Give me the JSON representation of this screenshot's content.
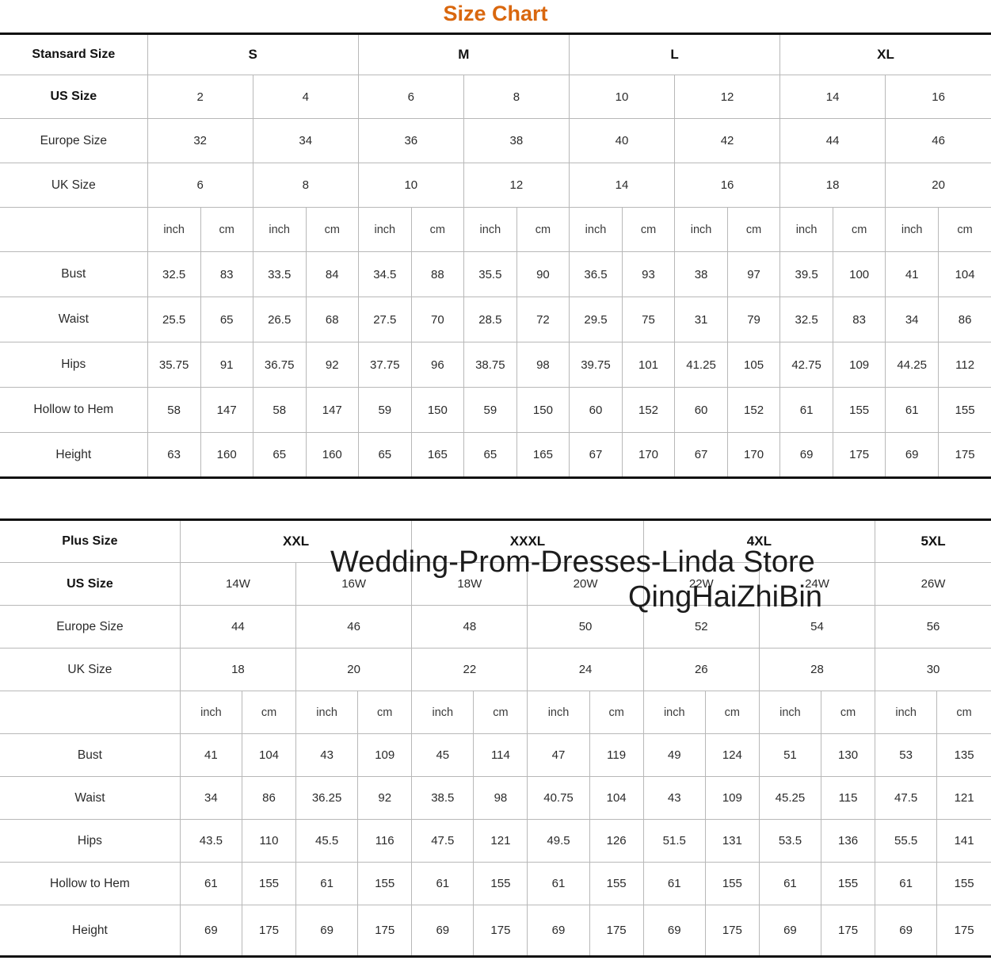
{
  "title": "Size Chart",
  "accent_color": "#d9670e",
  "watermark": {
    "line1": "Wedding-Prom-Dresses-Linda Store",
    "line2": "QingHaiZhiBin"
  },
  "units": {
    "inch": "inch",
    "cm": "cm"
  },
  "table1": {
    "corner_label": "Stansard Size",
    "groups": [
      {
        "label": "S",
        "span": 2
      },
      {
        "label": "M",
        "span": 2
      },
      {
        "label": "L",
        "span": 2
      },
      {
        "label": "XL",
        "span": 2
      }
    ],
    "rows": [
      {
        "label": "US Size",
        "bold": true,
        "values": [
          "2",
          "4",
          "6",
          "8",
          "10",
          "12",
          "14",
          "16"
        ]
      },
      {
        "label": "Europe Size",
        "bold": false,
        "values": [
          "32",
          "34",
          "36",
          "38",
          "40",
          "42",
          "44",
          "46"
        ]
      },
      {
        "label": "UK Size",
        "bold": false,
        "values": [
          "6",
          "8",
          "10",
          "12",
          "14",
          "16",
          "18",
          "20"
        ]
      }
    ],
    "unit_row": {
      "label": "",
      "units": [
        "inch",
        "cm",
        "inch",
        "cm",
        "inch",
        "cm",
        "inch",
        "cm",
        "inch",
        "cm",
        "inch",
        "cm",
        "inch",
        "cm",
        "inch",
        "cm"
      ]
    },
    "measure_rows": [
      {
        "label": "Bust",
        "values": [
          "32.5",
          "83",
          "33.5",
          "84",
          "34.5",
          "88",
          "35.5",
          "90",
          "36.5",
          "93",
          "38",
          "97",
          "39.5",
          "100",
          "41",
          "104"
        ]
      },
      {
        "label": "Waist",
        "values": [
          "25.5",
          "65",
          "26.5",
          "68",
          "27.5",
          "70",
          "28.5",
          "72",
          "29.5",
          "75",
          "31",
          "79",
          "32.5",
          "83",
          "34",
          "86"
        ]
      },
      {
        "label": "Hips",
        "values": [
          "35.75",
          "91",
          "36.75",
          "92",
          "37.75",
          "96",
          "38.75",
          "98",
          "39.75",
          "101",
          "41.25",
          "105",
          "42.75",
          "109",
          "44.25",
          "112"
        ]
      },
      {
        "label": "Hollow to Hem",
        "values": [
          "58",
          "147",
          "58",
          "147",
          "59",
          "150",
          "59",
          "150",
          "60",
          "152",
          "60",
          "152",
          "61",
          "155",
          "61",
          "155"
        ]
      },
      {
        "label": "Height",
        "values": [
          "63",
          "160",
          "65",
          "160",
          "65",
          "165",
          "65",
          "165",
          "67",
          "170",
          "67",
          "170",
          "69",
          "175",
          "69",
          "175"
        ]
      }
    ]
  },
  "table2": {
    "corner_label": "Plus Size",
    "groups": [
      {
        "label": "XXL",
        "span": 2
      },
      {
        "label": "XXXL",
        "span": 2
      },
      {
        "label": "4XL",
        "span": 2
      },
      {
        "label": "5XL",
        "span": 1
      }
    ],
    "rows": [
      {
        "label": "US Size",
        "bold": true,
        "values": [
          "14W",
          "16W",
          "18W",
          "20W",
          "22W",
          "24W",
          "26W"
        ]
      },
      {
        "label": "Europe Size",
        "bold": false,
        "values": [
          "44",
          "46",
          "48",
          "50",
          "52",
          "54",
          "56"
        ]
      },
      {
        "label": "UK Size",
        "bold": false,
        "values": [
          "18",
          "20",
          "22",
          "24",
          "26",
          "28",
          "30"
        ]
      }
    ],
    "unit_row": {
      "label": "",
      "units": [
        "inch",
        "cm",
        "inch",
        "cm",
        "inch",
        "cm",
        "inch",
        "cm",
        "inch",
        "cm",
        "inch",
        "cm",
        "inch",
        "cm"
      ]
    },
    "measure_rows": [
      {
        "label": "Bust",
        "values": [
          "41",
          "104",
          "43",
          "109",
          "45",
          "114",
          "47",
          "119",
          "49",
          "124",
          "51",
          "130",
          "53",
          "135"
        ]
      },
      {
        "label": "Waist",
        "values": [
          "34",
          "86",
          "36.25",
          "92",
          "38.5",
          "98",
          "40.75",
          "104",
          "43",
          "109",
          "45.25",
          "115",
          "47.5",
          "121"
        ]
      },
      {
        "label": "Hips",
        "values": [
          "43.5",
          "110",
          "45.5",
          "116",
          "47.5",
          "121",
          "49.5",
          "126",
          "51.5",
          "131",
          "53.5",
          "136",
          "55.5",
          "141"
        ]
      },
      {
        "label": "Hollow to Hem",
        "values": [
          "61",
          "155",
          "61",
          "155",
          "61",
          "155",
          "61",
          "155",
          "61",
          "155",
          "61",
          "155",
          "61",
          "155"
        ]
      },
      {
        "label": "Height",
        "values": [
          "69",
          "175",
          "69",
          "175",
          "69",
          "175",
          "69",
          "175",
          "69",
          "175",
          "69",
          "175",
          "69",
          "175"
        ]
      }
    ]
  }
}
